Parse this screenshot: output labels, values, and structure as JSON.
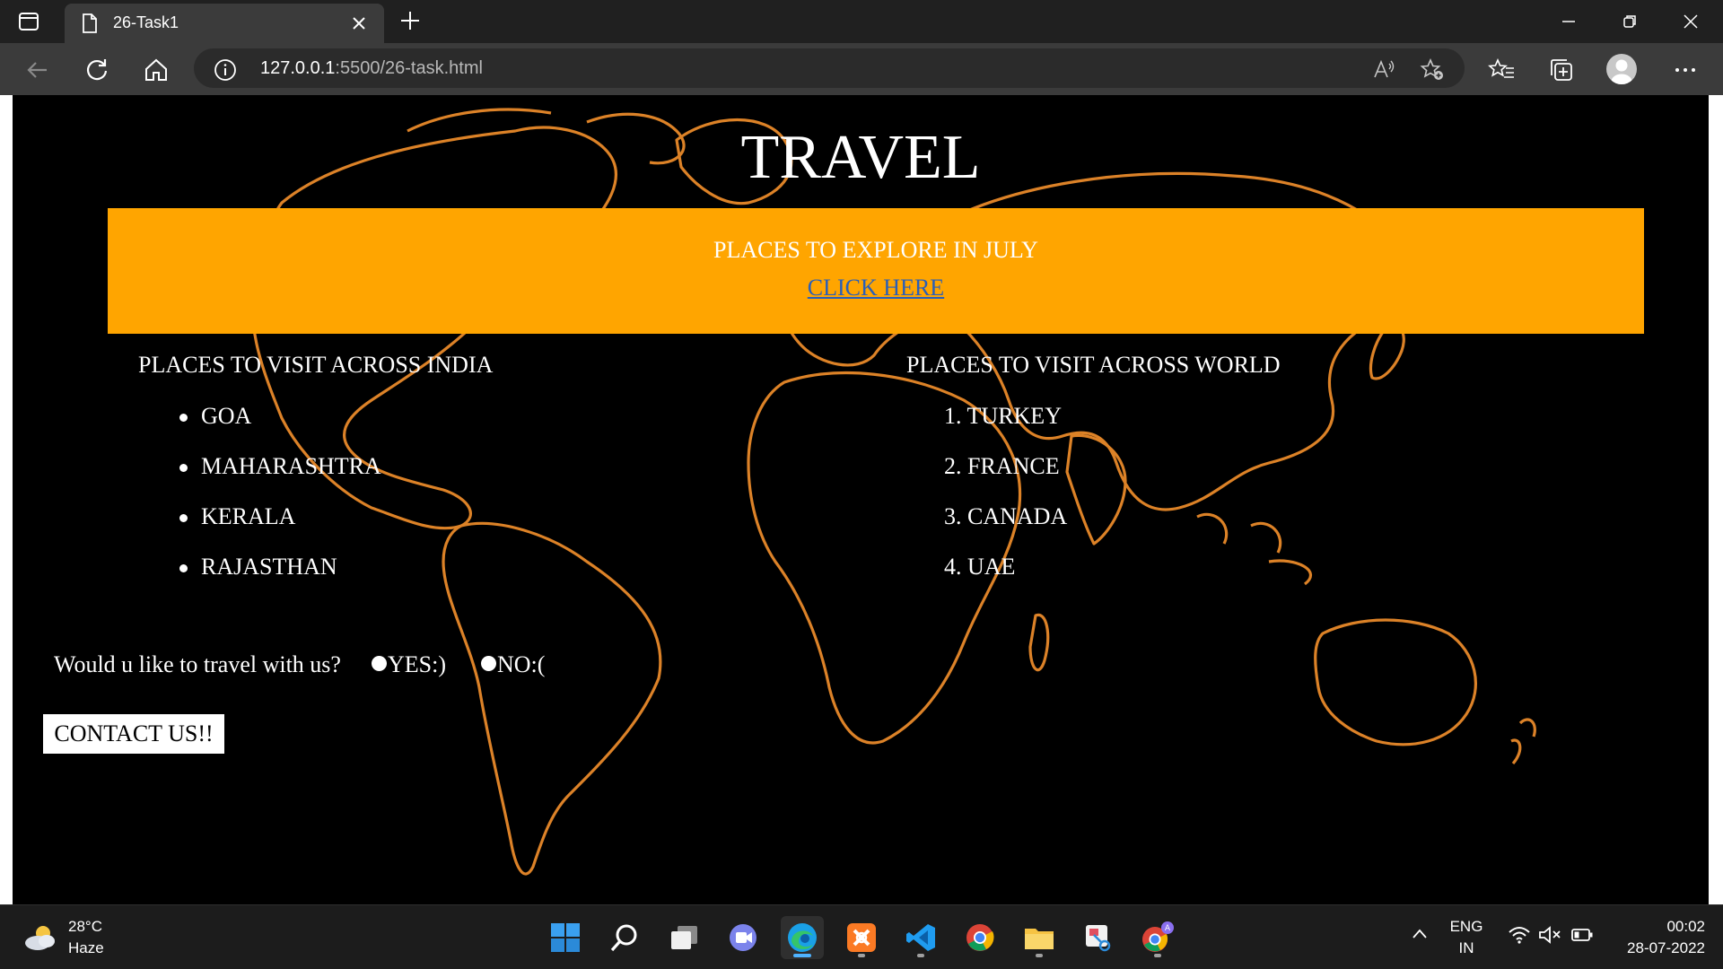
{
  "browser": {
    "tab_title": "26-Task1",
    "url_host": "127.0.0.1",
    "url_rest": ":5500/26-task.html"
  },
  "page": {
    "title": "TRAVEL",
    "banner": {
      "subtitle": "PLACES TO EXPLORE IN JULY",
      "link": "CLICK HERE"
    },
    "india": {
      "heading": "PLACES TO VISIT ACROSS INDIA",
      "items": [
        "GOA",
        "MAHARASHTRA",
        "KERALA",
        "RAJASTHAN"
      ]
    },
    "world": {
      "heading": "PLACES TO VISIT ACROSS WORLD",
      "items": [
        "1. TURKEY",
        "2. FRANCE",
        "3. CANADA",
        "4. UAE"
      ]
    },
    "question": "Would u like to travel with us?",
    "options": [
      "YES:)",
      "NO:("
    ],
    "contact_button": "CONTACT US!!",
    "colors": {
      "banner": "#ffa500",
      "link": "#2a5fb8",
      "map_outline": "#e8892a"
    }
  },
  "taskbar": {
    "weather": {
      "temp": "28°C",
      "desc": "Haze"
    },
    "language": {
      "lang": "ENG",
      "region": "IN"
    },
    "clock": {
      "time": "00:02",
      "date": "28-07-2022"
    },
    "apps": [
      "start-icon",
      "search-icon",
      "task-view-icon",
      "teams-chat-icon",
      "edge-icon",
      "xampp-icon",
      "vscode-icon",
      "chrome-icon",
      "file-explorer-icon",
      "snipping-tool-icon",
      "chrome-profile-icon"
    ]
  }
}
